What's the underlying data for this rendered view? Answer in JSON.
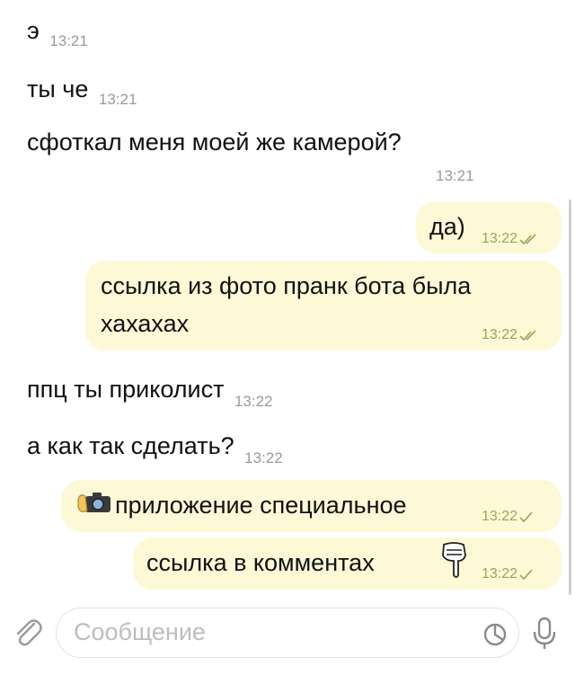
{
  "messages": [
    {
      "side": "in",
      "text": "э",
      "time": "13:21"
    },
    {
      "side": "in",
      "text": "ты че",
      "time": "13:21"
    },
    {
      "side": "in",
      "text": "сфоткал меня моей же камерой?",
      "time": "13:21"
    },
    {
      "side": "out",
      "text": "да)",
      "time": "13:22"
    },
    {
      "side": "out",
      "text_line1": "ссылка из фото пранк бота была",
      "text_line2": "хахахах",
      "time": "13:22"
    },
    {
      "side": "in",
      "text": "ппц ты приколист",
      "time": "13:22"
    },
    {
      "side": "in",
      "text": "а как так сделать?",
      "time": "13:22"
    },
    {
      "side": "out",
      "text": "приложение специальное",
      "time": "13:22",
      "emoji": "camera-hand-icon"
    },
    {
      "side": "out",
      "text": "ссылка в комментах",
      "time": "13:22",
      "emoji": "pointing-down-icon"
    }
  ],
  "composer": {
    "placeholder": "Сообщение"
  },
  "icons": {
    "attach": "paperclip-icon",
    "sticker": "sticker-icon",
    "mic": "microphone-icon"
  },
  "colors": {
    "bubble_out": "#fdf9d6",
    "time_out": "#9aa35a",
    "time_in": "#9a9a9a"
  }
}
